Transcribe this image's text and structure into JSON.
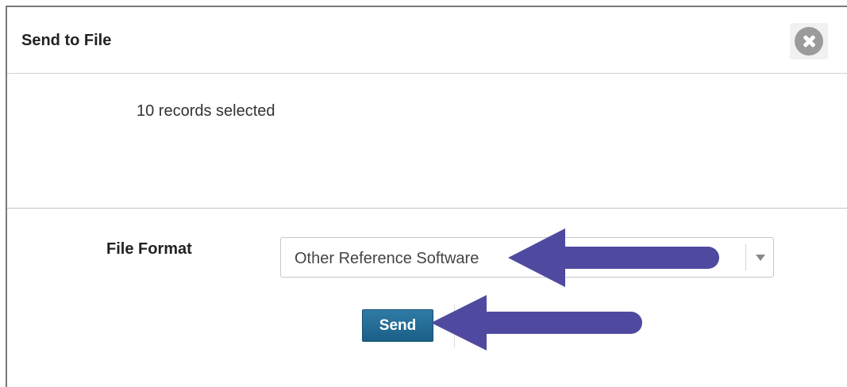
{
  "dialog": {
    "title": "Send to File",
    "close_icon": "close-x-circle-icon",
    "records_text": "10 records selected"
  },
  "form": {
    "file_format_label": "File Format",
    "file_format_value": "Other Reference Software",
    "dropdown_icon": "caret-down-icon",
    "send_label": "Send"
  },
  "annotation": {
    "arrow_color": "#4f4aa0"
  },
  "colors": {
    "send_button": "#1f6a94",
    "close_button": "#9b9b9b"
  }
}
